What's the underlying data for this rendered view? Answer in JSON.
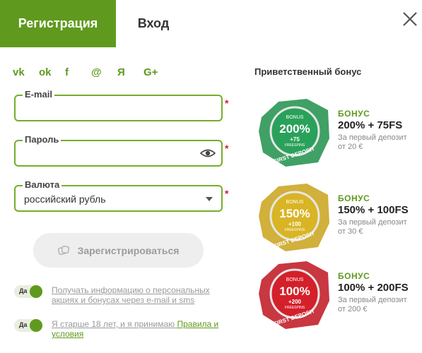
{
  "tabs": {
    "register": "Регистрация",
    "login": "Вход"
  },
  "social": [
    {
      "icon": "vk-icon",
      "glyph": "vk"
    },
    {
      "icon": "odnoklassniki-icon",
      "glyph": "ok"
    },
    {
      "icon": "facebook-icon",
      "glyph": "f"
    },
    {
      "icon": "mailru-icon",
      "glyph": "@"
    },
    {
      "icon": "yandex-icon",
      "glyph": "Я"
    },
    {
      "icon": "google-plus-icon",
      "glyph": "G+"
    }
  ],
  "form": {
    "email_label": "E-mail",
    "password_label": "Пароль",
    "currency_label": "Валюта",
    "currency_value": "российский рубль",
    "required_mark": "*",
    "submit_label": "Зарегистрироваться"
  },
  "toggles": [
    {
      "state": "Да",
      "text": "Получать информацию о персональных акциях и бонусах через e-mail и sms"
    },
    {
      "state": "Да",
      "text_prefix": "Я старше 18 лет, и я принимаю ",
      "link": "Правила и условия"
    }
  ],
  "bonus": {
    "title": "Приветственный бонус",
    "items": [
      {
        "badge_top": "BONUS",
        "badge_pct": "200%",
        "badge_fs": "+75",
        "badge_fs_label": "FREESPINS",
        "badge_ribbon": "FIRST DEPOSIT",
        "kicker": "БОНУС",
        "value": "200% + 75FS",
        "note1": "За первый депозит",
        "note2": "от 20 €",
        "color": "#1e8f4a"
      },
      {
        "badge_top": "BONUS",
        "badge_pct": "150%",
        "badge_fs": "+100",
        "badge_fs_label": "FREESPINS",
        "badge_ribbon": "FIRST DEPOSIT",
        "kicker": "БОНУС",
        "value": "150% + 100FS",
        "note1": "За первый депозит",
        "note2": "от 30 €",
        "color": "#c9a21a"
      },
      {
        "badge_top": "BONUS",
        "badge_pct": "100%",
        "badge_fs": "+200",
        "badge_fs_label": "FREESPINS",
        "badge_ribbon": "FIRST DEPOSIT",
        "kicker": "БОНУС",
        "value": "100% + 200FS",
        "note1": "За первый депозит",
        "note2": "от 200 €",
        "color": "#c0141e"
      }
    ]
  },
  "colors": {
    "accent": "#5f9a1e",
    "required": "#d12030"
  }
}
